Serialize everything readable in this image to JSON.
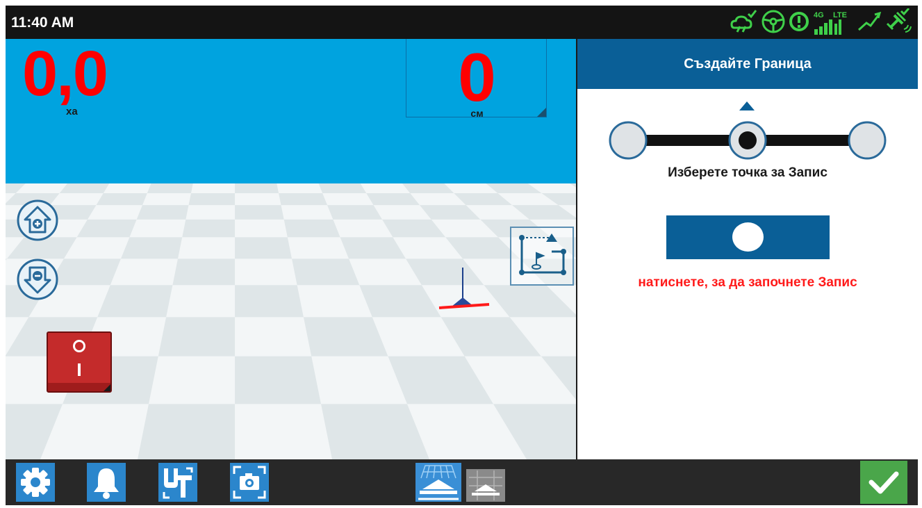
{
  "status_bar": {
    "time": "11:40 AM",
    "icons": [
      "weather-check-icon",
      "steering-wheel-icon",
      "alert-icon",
      "cellular-4g-lte-icon",
      "gnss-correction-icon",
      "satellite-icon"
    ],
    "network_label_4g": "4G",
    "network_label_lte": "LTE",
    "icon_color": "#3fd04a"
  },
  "map": {
    "area_value": "0,0",
    "area_unit": "ха",
    "offset_value": "0",
    "offset_unit": "см",
    "sky_color": "#00a3df",
    "value_color": "#ff0000"
  },
  "panel": {
    "title": "Създайте Граница",
    "point_selector_label": "Изберете точка за Запис",
    "selected_point": 2,
    "points": 3,
    "record_hint": "натиснете, за да започнете Запис",
    "accent_color": "#0a5f97"
  },
  "bottom_bar": {
    "buttons": [
      "settings-icon",
      "alarm-bell-icon",
      "universal-terminal-icon",
      "screenshot-icon",
      "3d-view-icon",
      "2d-view-icon",
      "confirm-check-icon"
    ]
  }
}
